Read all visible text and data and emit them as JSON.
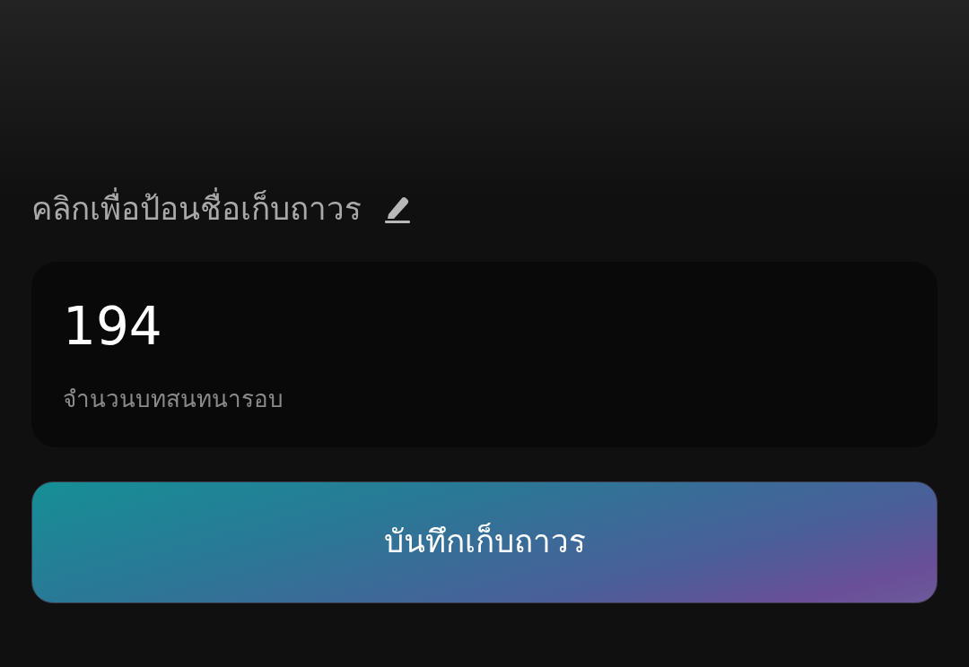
{
  "name_prompt": {
    "text": "คลิกเพื่อป้อนชื่อเก็บถาวร"
  },
  "stat_card": {
    "value": "194",
    "label": "จำนวนบทสนทนารอบ"
  },
  "save_button": {
    "label": "บันทึกเก็บถาวร"
  }
}
